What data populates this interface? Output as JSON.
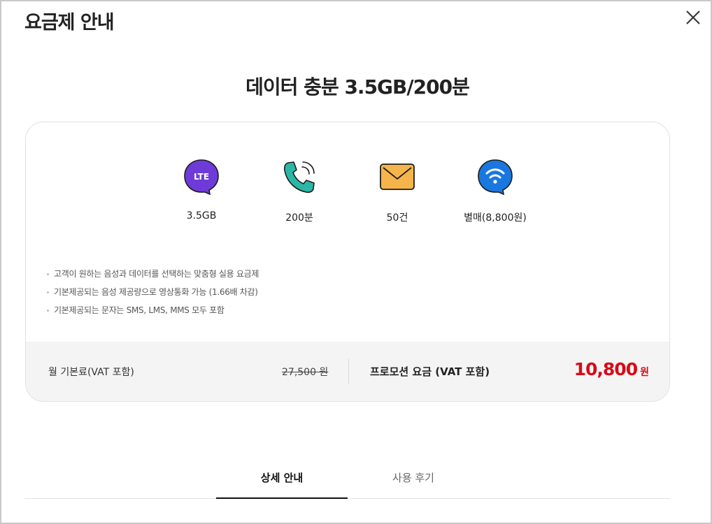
{
  "modal": {
    "title": "요금제 안내"
  },
  "plan": {
    "name": "데이터 충분 3.5GB/200분"
  },
  "features": [
    {
      "icon": "lte-icon",
      "label": "3.5GB",
      "badge": "LTE",
      "color": "#6e3bd9"
    },
    {
      "icon": "phone-call-icon",
      "label": "200분",
      "color": "#2bb7a6"
    },
    {
      "icon": "envelope-icon",
      "label": "50건",
      "color": "#f5b54a"
    },
    {
      "icon": "wifi-icon",
      "label": "별매(8,800원)",
      "color": "#1a77e0"
    }
  ],
  "notes": [
    "고객이 원하는 음성과 데이터를 선택하는 맞춤형 실용 요금제",
    "기본제공되는 음성 제공량으로 영상통화 가능 (1.66배 차감)",
    "기본제공되는 문자는 SMS, LMS, MMS 모두 포함"
  ],
  "pricing": {
    "base_label": "월 기본료(VAT 포함)",
    "base_price": "27,500 원",
    "promo_label": "프로모션 요금 (VAT 포함)",
    "promo_price": "10,800",
    "promo_unit": "원",
    "promo_color": "#d90a16"
  },
  "tabs": [
    {
      "label": "상세 안내",
      "active": true
    },
    {
      "label": "사용 후기",
      "active": false
    }
  ]
}
